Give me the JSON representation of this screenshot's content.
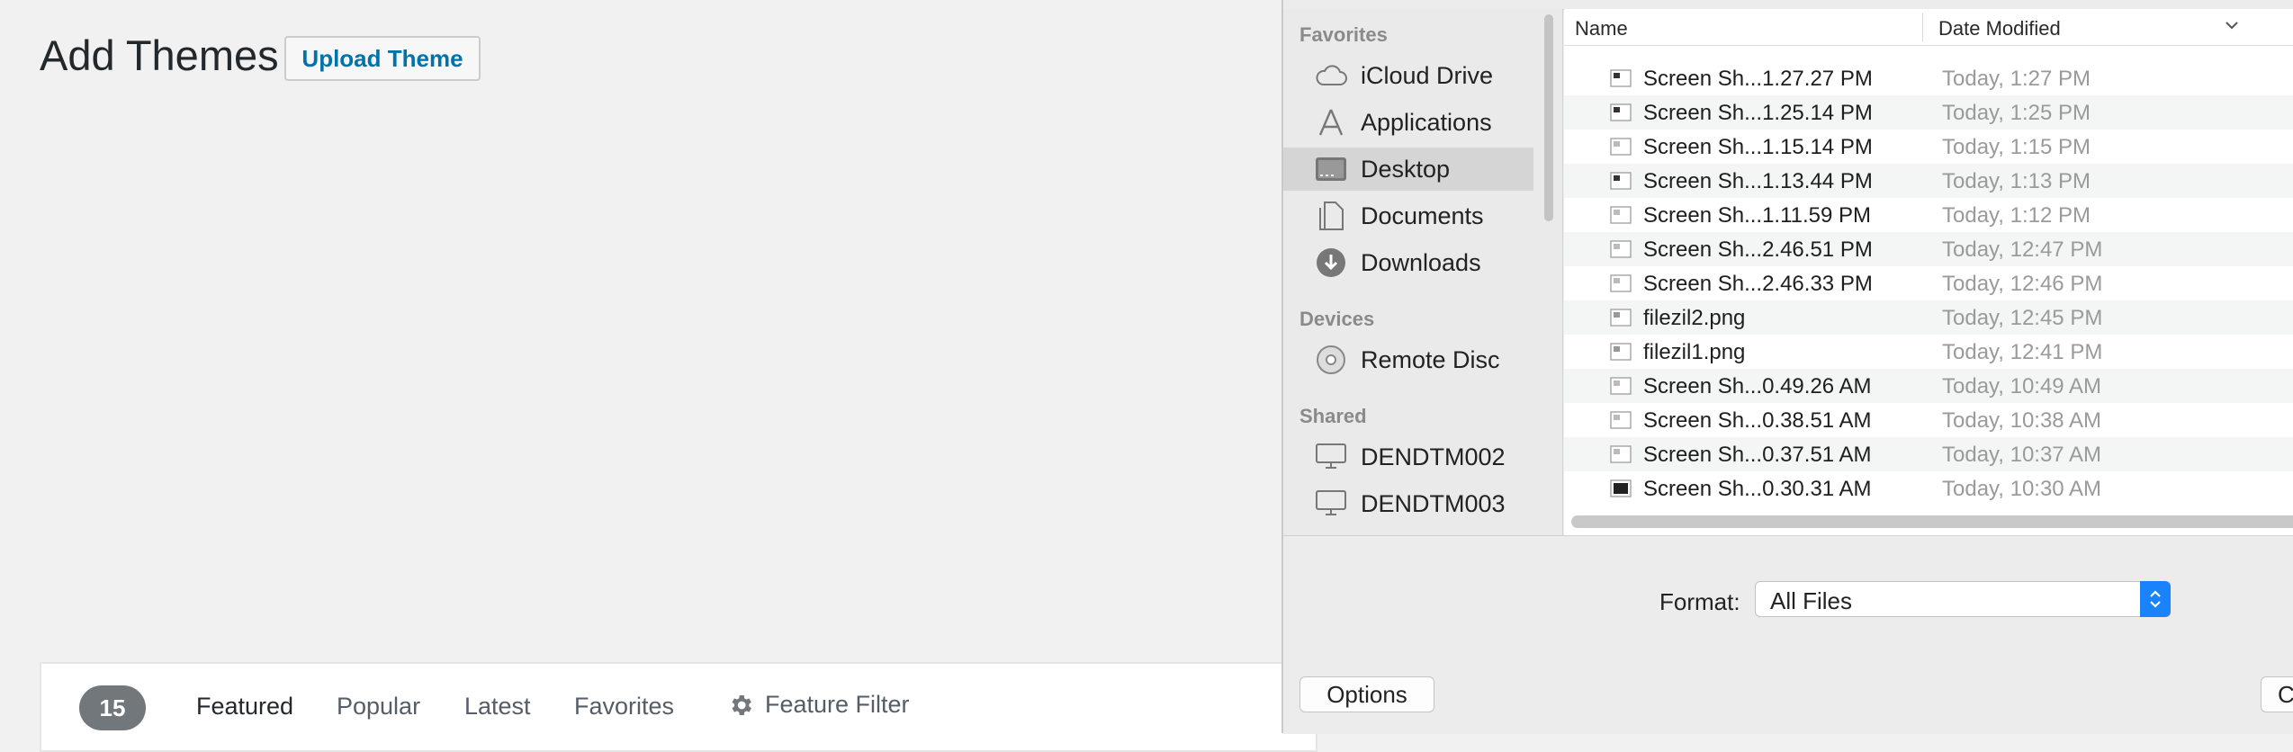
{
  "page": {
    "title": "Add Themes",
    "upload_button": "Upload Theme"
  },
  "filters": {
    "count": "15",
    "tabs": [
      "Featured",
      "Popular",
      "Latest",
      "Favorites"
    ],
    "feature_filter": "Feature Filter"
  },
  "dialog": {
    "sidebar": {
      "favorites_heading": "Favorites",
      "favorites": [
        "iCloud Drive",
        "Applications",
        "Desktop",
        "Documents",
        "Downloads"
      ],
      "devices_heading": "Devices",
      "devices": [
        "Remote Disc"
      ],
      "shared_heading": "Shared",
      "shared": [
        "DENDTM002",
        "DENDTM003"
      ]
    },
    "columns": {
      "name": "Name",
      "date": "Date Modified"
    },
    "files": [
      {
        "name": "Screen Sh...1.27.27 PM",
        "date": "Today, 1:27 PM"
      },
      {
        "name": "Screen Sh...1.25.14 PM",
        "date": "Today, 1:25 PM"
      },
      {
        "name": "Screen Sh...1.15.14 PM",
        "date": "Today, 1:15 PM"
      },
      {
        "name": "Screen Sh...1.13.44 PM",
        "date": "Today, 1:13 PM"
      },
      {
        "name": "Screen Sh...1.11.59 PM",
        "date": "Today, 1:12 PM"
      },
      {
        "name": "Screen Sh...2.46.51 PM",
        "date": "Today, 12:47 PM"
      },
      {
        "name": "Screen Sh...2.46.33 PM",
        "date": "Today, 12:46 PM"
      },
      {
        "name": "filezil2.png",
        "date": "Today, 12:45 PM"
      },
      {
        "name": "filezil1.png",
        "date": "Today, 12:41 PM"
      },
      {
        "name": "Screen Sh...0.49.26 AM",
        "date": "Today, 10:49 AM"
      },
      {
        "name": "Screen Sh...0.38.51 AM",
        "date": "Today, 10:38 AM"
      },
      {
        "name": "Screen Sh...0.37.51 AM",
        "date": "Today, 10:37 AM"
      },
      {
        "name": "Screen Sh...0.30.31 AM",
        "date": "Today, 10:30 AM"
      }
    ],
    "format_label": "Format:",
    "format_value": "All Files",
    "options_button": "Options",
    "cancel_button": "Cancel"
  },
  "colors": {
    "wp_link": "#0073aa",
    "badge": "#72777c",
    "select_accent": "#1a82fb"
  }
}
